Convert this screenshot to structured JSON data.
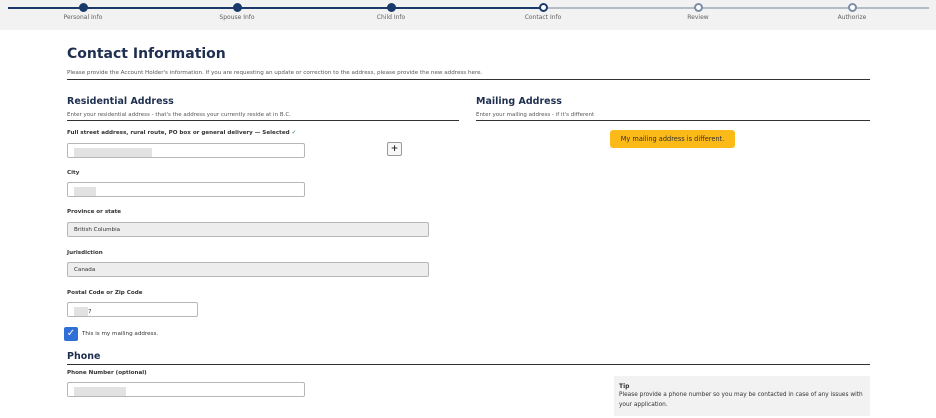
{
  "progress": {
    "steps": [
      {
        "label": "Personal Info",
        "state": "done"
      },
      {
        "label": "Spouse Info",
        "state": "done"
      },
      {
        "label": "Child Info",
        "state": "done"
      },
      {
        "label": "Contact Info",
        "state": "current"
      },
      {
        "label": "Review",
        "state": "todo"
      },
      {
        "label": "Authorize",
        "state": "todo"
      }
    ]
  },
  "page": {
    "title": "Contact Information",
    "intro": "Please provide the Account Holder's information. If you are requesting an update or correction to the address, please provide the new address here."
  },
  "residential": {
    "heading": "Residential Address",
    "subtext": "Enter your residential address - that's the address your currently reside at in B.C.",
    "street_label": "Full street address, rural route, PO box or general delivery — Selected",
    "add_label": "+",
    "city_label": "City",
    "province_label": "Province or state",
    "province_value": "British Columbia",
    "jurisdiction_label": "Jurisdiction",
    "jurisdiction_value": "Canada",
    "postal_label": "Postal Code or Zip Code",
    "postal_value_visible": "7",
    "same_as_mailing_label": "This is my mailing address."
  },
  "mailing": {
    "heading": "Mailing Address",
    "subtext": "Enter your mailing address - if it's different",
    "different_button": "My mailing address is different."
  },
  "phone": {
    "heading": "Phone",
    "phone_label": "Phone Number (optional)"
  },
  "tip": {
    "title": "Tip",
    "text_line1": "Please provide a phone number so you may be contacted in case of any issues with",
    "text_line2": "your application."
  },
  "colors": {
    "primary": "#1a3a6b",
    "heading": "#1f2f4f",
    "accent_button": "#fcba19",
    "checkbox": "#2f6fd6",
    "valid_check": "#2e8540"
  }
}
